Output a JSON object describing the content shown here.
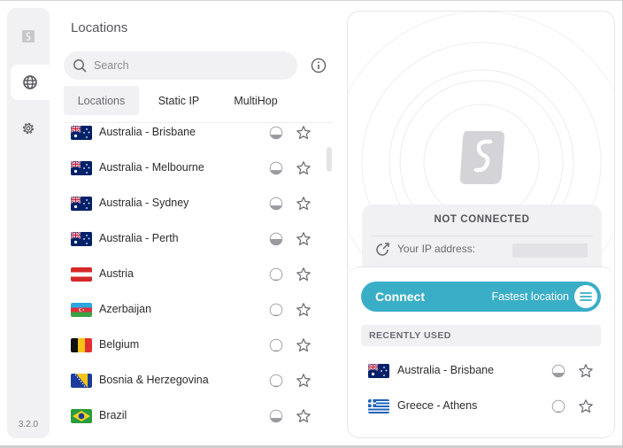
{
  "app": {
    "version": "3.2.0"
  },
  "sidebar": {
    "items": [
      {
        "name": "logo",
        "icon": "surfshark-logo-icon"
      },
      {
        "name": "locations",
        "icon": "globe-icon",
        "active": true
      },
      {
        "name": "settings",
        "icon": "gear-icon"
      }
    ]
  },
  "locations_panel": {
    "title": "Locations",
    "search": {
      "placeholder": "Search",
      "value": ""
    },
    "tabs": [
      {
        "label": "Locations",
        "active": true
      },
      {
        "label": "Static IP",
        "active": false
      },
      {
        "label": "MultiHop",
        "active": false
      }
    ],
    "rows": [
      {
        "label": "Australia - Brisbane",
        "flag": "au",
        "load": 0.35
      },
      {
        "label": "Australia - Melbourne",
        "flag": "au",
        "load": 0.35
      },
      {
        "label": "Australia - Sydney",
        "flag": "au",
        "load": 0.35
      },
      {
        "label": "Australia - Perth",
        "flag": "au",
        "load": 0.5
      },
      {
        "label": "Austria",
        "flag": "at",
        "load": 0.1
      },
      {
        "label": "Azerbaijan",
        "flag": "az",
        "load": 0.1
      },
      {
        "label": "Belgium",
        "flag": "be",
        "load": 0.1
      },
      {
        "label": "Bosnia & Herzegovina",
        "flag": "ba",
        "load": 0.1
      },
      {
        "label": "Brazil",
        "flag": "br",
        "load": 0.35
      }
    ]
  },
  "connection": {
    "status": "NOT CONNECTED",
    "ip_label": "Your IP address:",
    "connect_label": "Connect",
    "fastest_label": "Fastest location",
    "recently_used_header": "RECENTLY USED",
    "recent": [
      {
        "label": "Australia - Brisbane",
        "flag": "au",
        "load": 0.35
      },
      {
        "label": "Greece - Athens",
        "flag": "gr",
        "load": 0.1
      }
    ]
  },
  "colors": {
    "accent": "#3aaec7",
    "panel_bg": "#f1f1f3",
    "text": "#2c2c2e"
  }
}
